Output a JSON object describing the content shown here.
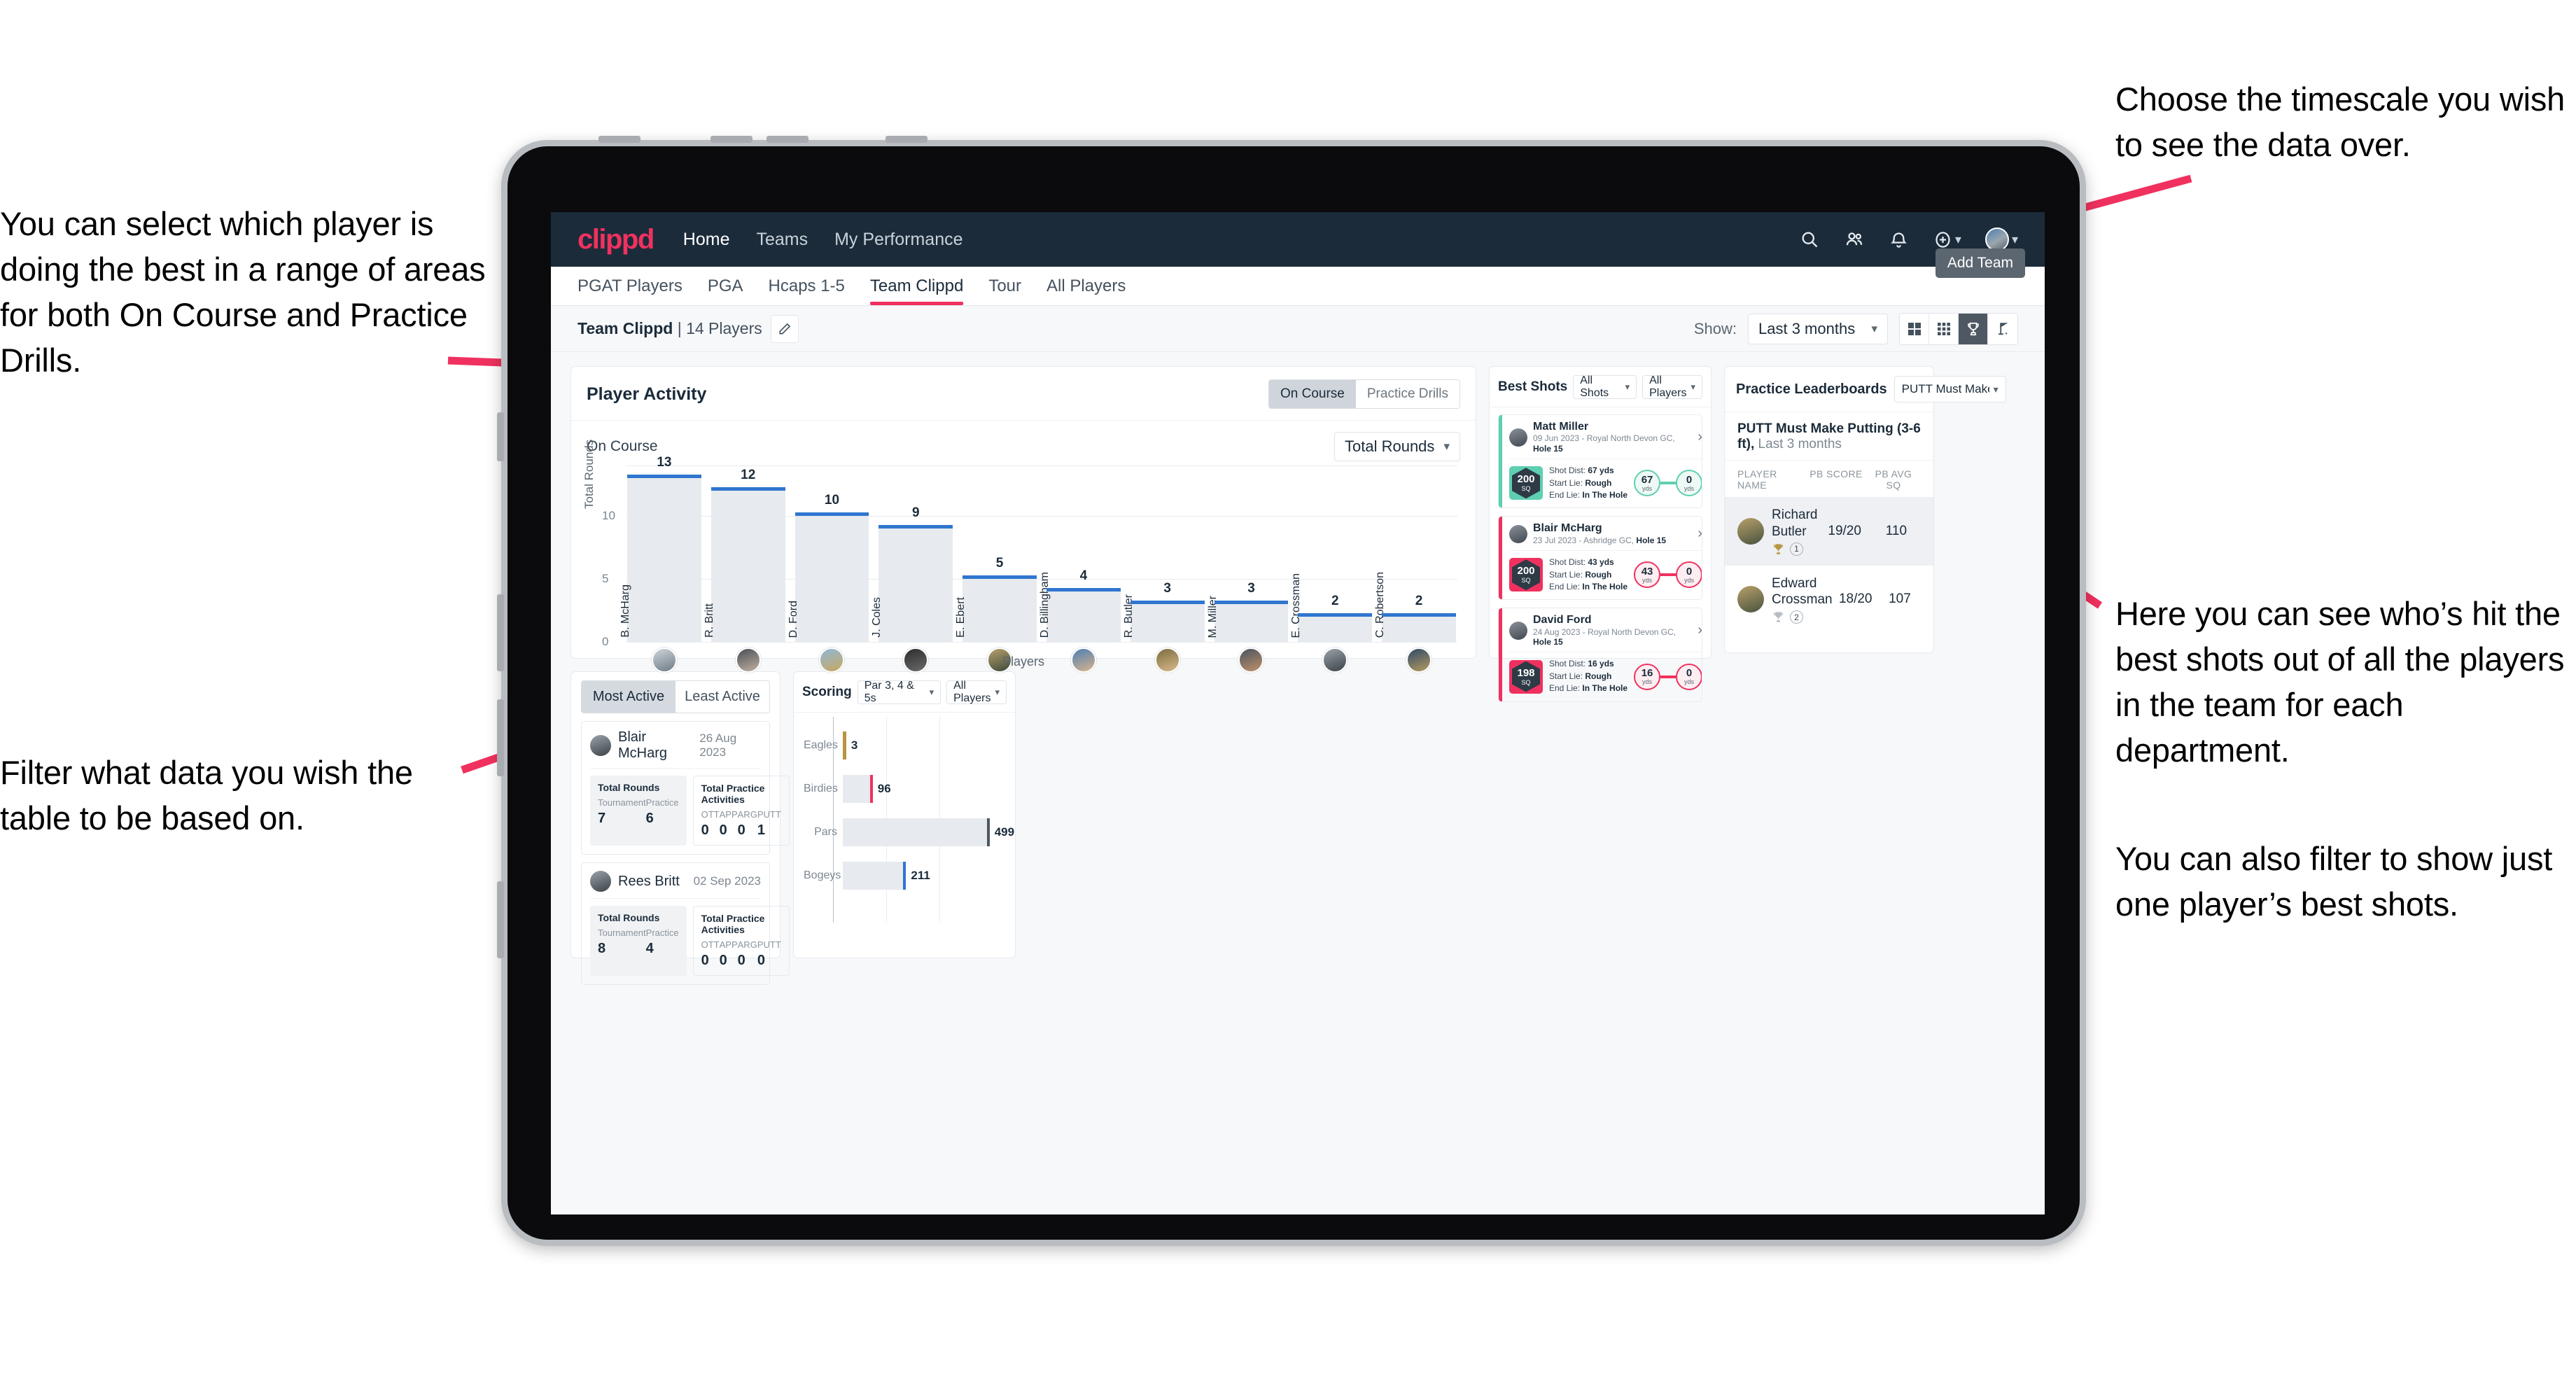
{
  "annotations": {
    "timescale": "Choose the timescale you wish to see the data over.",
    "select_player": "You can select which player is doing the best in a range of areas for both On Course and Practice Drills.",
    "filter_table": "Filter what data you wish the table to be based on.",
    "best_shots": "Here you can see who’s hit the best shots out of all the players in the team for each department.",
    "filter_one_player": "You can also filter to show just one player’s best shots."
  },
  "colors": {
    "brand_pink": "#f0315f",
    "nav_dark": "#1b2b3a",
    "bar_blue": "#2f76d0",
    "teal": "#5ecfb1",
    "gold": "#b89440"
  },
  "topnav": {
    "logo": "clippd",
    "links": [
      {
        "label": "Home",
        "active": true
      },
      {
        "label": "Teams",
        "active": false
      },
      {
        "label": "My Performance",
        "active": false
      }
    ],
    "icons": [
      "search-icon",
      "people-icon",
      "bell-icon",
      "plus-circle-icon",
      "avatar"
    ]
  },
  "subtabs": {
    "items": [
      {
        "label": "PGAT Players",
        "active": false
      },
      {
        "label": "PGA",
        "active": false
      },
      {
        "label": "Hcaps 1-5",
        "active": false
      },
      {
        "label": "Team Clippd",
        "active": true
      },
      {
        "label": "Tour",
        "active": false
      },
      {
        "label": "All Players",
        "active": false
      }
    ],
    "tooltip": "Add Team"
  },
  "toolbar": {
    "team_name": "Team Clippd",
    "separator": "|",
    "player_count": "14 Players",
    "show_label": "Show:",
    "range_value": "Last 3 months",
    "view_toggles": [
      {
        "name": "grid-2x2-icon",
        "active": false
      },
      {
        "name": "grid-3x3-icon",
        "active": false
      },
      {
        "name": "trophy-icon",
        "active": true
      },
      {
        "name": "flag-icon",
        "active": false
      }
    ]
  },
  "player_activity": {
    "title": "Player Activity",
    "segmented": [
      {
        "label": "On Course",
        "active": true
      },
      {
        "label": "Practice Drills",
        "active": false
      }
    ],
    "sub_title": "On Course",
    "metric_select": "Total Rounds"
  },
  "chart_data": [
    {
      "type": "bar",
      "title": "Player Activity — On Course",
      "xlabel": "Players",
      "ylabel": "Total Rounds",
      "ylim": [
        0,
        14
      ],
      "yticks": [
        0,
        5,
        10
      ],
      "grid": true,
      "categories": [
        "B. McHarg",
        "R. Britt",
        "D. Ford",
        "J. Coles",
        "E. Ebert",
        "D. Billingham",
        "R. Butler",
        "M. Miller",
        "E. Crossman",
        "C. Robertson"
      ],
      "values": [
        13,
        12,
        10,
        9,
        5,
        4,
        3,
        3,
        2,
        2
      ]
    },
    {
      "type": "bar",
      "title": "Scoring",
      "orientation": "horizontal",
      "xlabel": "",
      "ylabel": "",
      "categories": [
        "Eagles",
        "Birdies",
        "Pars",
        "Bogeys"
      ],
      "values": [
        3,
        96,
        499,
        211
      ],
      "xlim": [
        0,
        560
      ],
      "grid": true,
      "colors": [
        "#b89440",
        "#f0315f",
        "#4d5862",
        "#2f76d0"
      ]
    }
  ],
  "best_shots": {
    "title": "Best Shots",
    "filter_shots": "All Shots",
    "filter_players": "All Players",
    "cards": [
      {
        "player": "Matt Miller",
        "meta_date": "09 Jun 2023 - Royal North Devon GC,",
        "meta_hole": "Hole 15",
        "badge_value": "200",
        "badge_unit": "SQ",
        "accent": "#5ecfb1",
        "shot_dist_label": "Shot Dist:",
        "shot_dist": "67 yds",
        "start_lie_label": "Start Lie:",
        "start_lie": "Rough",
        "end_lie_label": "End Lie:",
        "end_lie": "In The Hole",
        "from_value": "67",
        "from_unit": "yds",
        "to_value": "0",
        "to_unit": "yds"
      },
      {
        "player": "Blair McHarg",
        "meta_date": "23 Jul 2023 - Ashridge GC,",
        "meta_hole": "Hole 15",
        "badge_value": "200",
        "badge_unit": "SQ",
        "accent": "#f0315f",
        "shot_dist_label": "Shot Dist:",
        "shot_dist": "43 yds",
        "start_lie_label": "Start Lie:",
        "start_lie": "Rough",
        "end_lie_label": "End Lie:",
        "end_lie": "In The Hole",
        "from_value": "43",
        "from_unit": "yds",
        "to_value": "0",
        "to_unit": "yds"
      },
      {
        "player": "David Ford",
        "meta_date": "24 Aug 2023 - Royal North Devon GC,",
        "meta_hole": "Hole 15",
        "badge_value": "198",
        "badge_unit": "SQ",
        "accent": "#f0315f",
        "shot_dist_label": "Shot Dist:",
        "shot_dist": "16 yds",
        "start_lie_label": "Start Lie:",
        "start_lie": "Rough",
        "end_lie_label": "End Lie:",
        "end_lie": "In The Hole",
        "from_value": "16",
        "from_unit": "yds",
        "to_value": "0",
        "to_unit": "yds"
      }
    ]
  },
  "practice_leaderboards": {
    "title": "Practice Leaderboards",
    "drill_select": "PUTT Must Make Putting ...",
    "subtitle_bold": "PUTT Must Make Putting (3-6 ft),",
    "subtitle_rest": "Last 3 months",
    "columns": [
      "PLAYER NAME",
      "PB SCORE",
      "PB AVG SQ"
    ],
    "rows": [
      {
        "name": "Richard Butler",
        "rank": "1",
        "pb_score": "19/20",
        "pb_avg_sq": "110",
        "trophy": "gold"
      },
      {
        "name": "Edward Crossman",
        "rank": "2",
        "pb_score": "18/20",
        "pb_avg_sq": "107",
        "trophy": "silver"
      }
    ]
  },
  "activity_panel": {
    "tabs": [
      {
        "label": "Most Active",
        "active": true
      },
      {
        "label": "Least Active",
        "active": false
      }
    ],
    "cards": [
      {
        "player": "Blair McHarg",
        "date": "26 Aug 2023",
        "rounds_title": "Total Rounds",
        "rounds": [
          {
            "label": "Tournament",
            "value": "7"
          },
          {
            "label": "Practice",
            "value": "6"
          }
        ],
        "practice_title": "Total Practice Activities",
        "practice": [
          {
            "label": "OTT",
            "value": "0"
          },
          {
            "label": "APP",
            "value": "0"
          },
          {
            "label": "ARG",
            "value": "0"
          },
          {
            "label": "PUTT",
            "value": "1"
          }
        ]
      },
      {
        "player": "Rees Britt",
        "date": "02 Sep 2023",
        "rounds_title": "Total Rounds",
        "rounds": [
          {
            "label": "Tournament",
            "value": "8"
          },
          {
            "label": "Practice",
            "value": "4"
          }
        ],
        "practice_title": "Total Practice Activities",
        "practice": [
          {
            "label": "OTT",
            "value": "0"
          },
          {
            "label": "APP",
            "value": "0"
          },
          {
            "label": "ARG",
            "value": "0"
          },
          {
            "label": "PUTT",
            "value": "0"
          }
        ]
      }
    ]
  },
  "scoring": {
    "title": "Scoring",
    "filter_par": "Par 3, 4 & 5s",
    "filter_players": "All Players"
  }
}
